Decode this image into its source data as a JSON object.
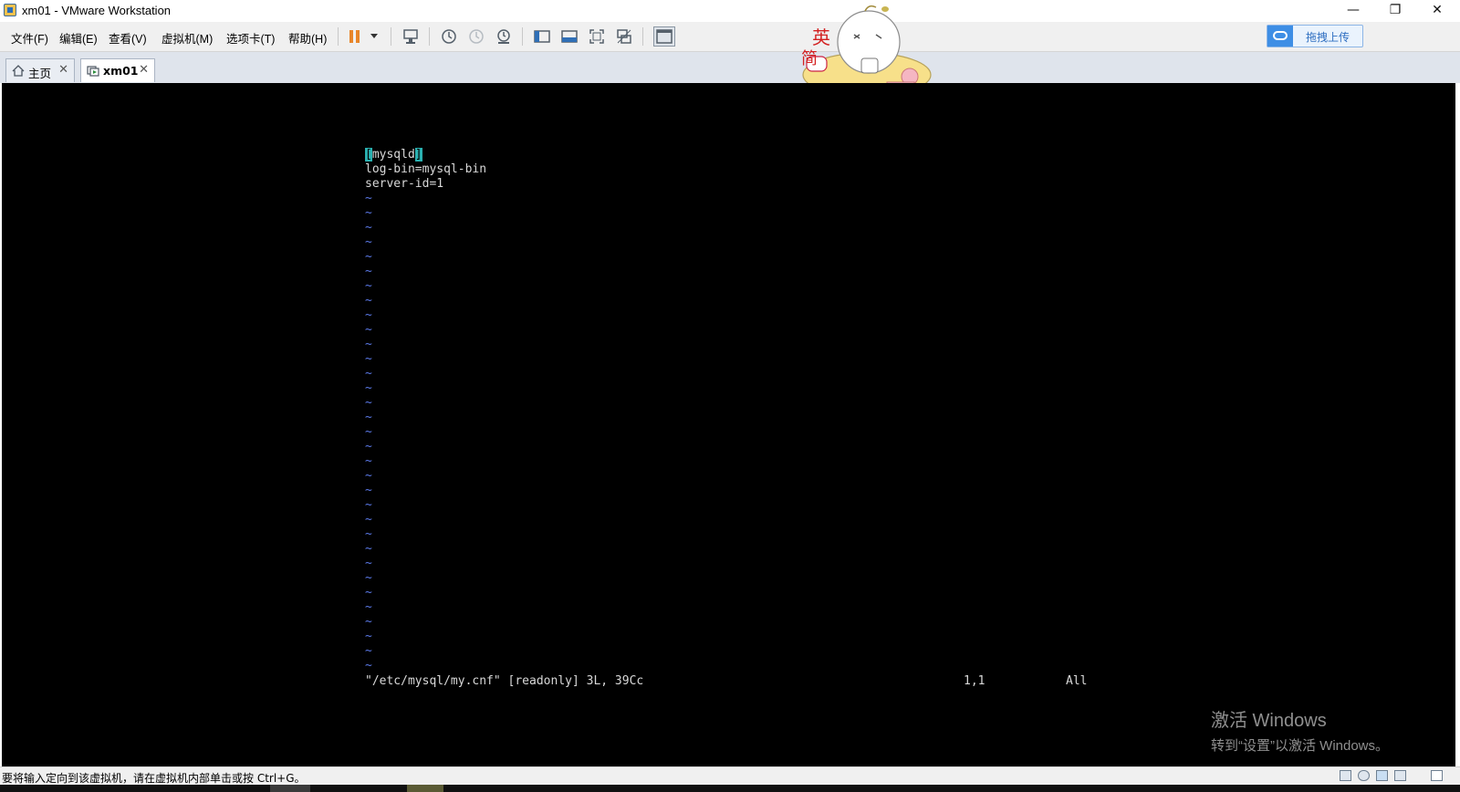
{
  "window": {
    "title": "xm01 - VMware Workstation"
  },
  "menu": {
    "items": [
      "文件(F)",
      "编辑(E)",
      "查看(V)",
      "虚拟机(M)",
      "选项卡(T)",
      "帮助(H)"
    ]
  },
  "upload_button": {
    "label": "拖拽上传"
  },
  "mascot": {
    "text_top": "英",
    "text_bottom": "简"
  },
  "tabs": [
    {
      "label": "主页",
      "icon": "home-icon"
    },
    {
      "label": "xm01",
      "icon": "vm-icon"
    }
  ],
  "vim": {
    "cursor_char": "[",
    "line1_rest": "mysqld",
    "line1_end": "]",
    "line2": "log-bin=mysql-bin",
    "line3": "server-id=1",
    "tilde": "~",
    "status_file": "\"/etc/mysql/my.cnf\" [readonly] 3L, 39Cc",
    "status_pos": "1,1",
    "status_all": "All"
  },
  "activation": {
    "line1": "激活 Windows",
    "line2": "转到“设置”以激活 Windows。"
  },
  "statusbar": {
    "message": "要将输入定向到该虚拟机，请在虚拟机内部单击或按 Ctrl+G。"
  }
}
